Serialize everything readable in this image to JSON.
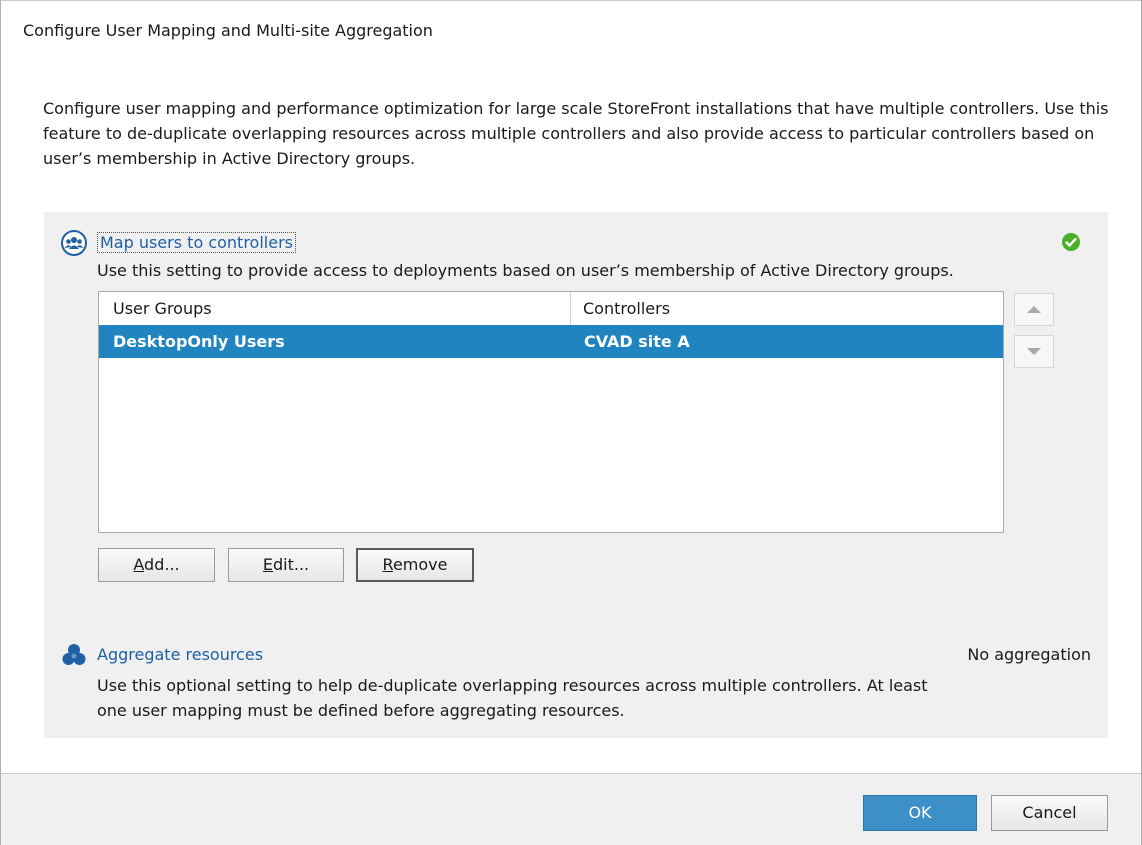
{
  "dialog": {
    "title": "Configure User Mapping and Multi-site Aggregation",
    "description": "Configure user mapping and performance optimization for large scale StoreFront installations that have multiple controllers. Use this feature to de-duplicate overlapping resources across multiple controllers and also provide access to particular controllers based on user’s membership in Active Directory groups."
  },
  "map_users": {
    "link": "Map users to controllers",
    "description": "Use this setting to provide access to deployments based on user’s membership of Active Directory groups.",
    "status_icon": "check-circle-icon",
    "table": {
      "columns": [
        "User Groups",
        "Controllers"
      ],
      "rows": [
        {
          "user_group": "DesktopOnly Users",
          "controller": "CVAD site A",
          "selected": true
        }
      ]
    },
    "buttons": {
      "add": {
        "mnemonic": "A",
        "rest": "dd..."
      },
      "edit": {
        "mnemonic": "E",
        "rest": "dit..."
      },
      "remove": {
        "mnemonic": "R",
        "rest": "emove"
      }
    }
  },
  "aggregate": {
    "link": "Aggregate resources",
    "status": "No aggregation",
    "description": "Use this optional setting to help de-duplicate overlapping resources across multiple controllers. At least one user mapping must be defined before aggregating resources."
  },
  "footer": {
    "ok_label": "OK",
    "cancel_label": "Cancel"
  },
  "colors": {
    "link": "#1f5fa3",
    "selection": "#1f84c0",
    "ok_button": "#3d8fc7",
    "panel_bg": "#f0f0f0",
    "success": "#4caf2a"
  }
}
